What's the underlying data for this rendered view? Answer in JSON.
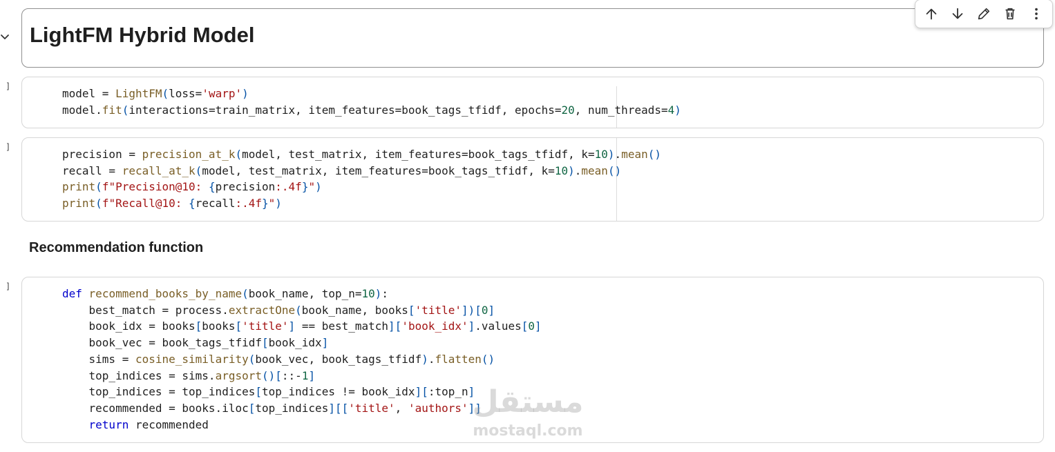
{
  "markdown_cell": {
    "title": "LightFM Hybrid Model"
  },
  "toolbar": {
    "buttons": [
      "arrow-up-icon",
      "arrow-down-icon",
      "pencil-icon",
      "trash-icon",
      "more-vert-icon"
    ]
  },
  "cell_brackets": [
    "]",
    "]",
    "]"
  ],
  "code_cells": [
    {
      "lines": [
        "model = LightFM(loss='warp')",
        "model.fit(interactions=train_matrix, item_features=book_tags_tfidf, epochs=20, num_threads=4)"
      ]
    },
    {
      "lines": [
        "precision = precision_at_k(model, test_matrix, item_features=book_tags_tfidf, k=10).mean()",
        "recall = recall_at_k(model, test_matrix, item_features=book_tags_tfidf, k=10).mean()",
        "print(f\"Precision@10: {precision:.4f}\")",
        "print(f\"Recall@10: {recall:.4f}\")"
      ]
    },
    {
      "lines": [
        "def recommend_books_by_name(book_name, top_n=10):",
        "    best_match = process.extractOne(book_name, books['title'])[0]",
        "    book_idx = books[books['title'] == best_match]['book_idx'].values[0]",
        "    book_vec = book_tags_tfidf[book_idx]",
        "    sims = cosine_similarity(book_vec, book_tags_tfidf).flatten()",
        "    top_indices = sims.argsort()[::-1]",
        "    top_indices = top_indices[top_indices != book_idx][:top_n]",
        "    recommended = books.iloc[top_indices][['title', 'authors']]",
        "    return recommended"
      ]
    }
  ],
  "section_heading": "Recommendation function",
  "watermark": {
    "arabic": "مستقل",
    "latin": "mostaql.com"
  },
  "colors": {
    "keyword": "#0000cc",
    "string": "#a31515",
    "number": "#116644",
    "function": "#795e26",
    "paren": "#0451a5"
  }
}
